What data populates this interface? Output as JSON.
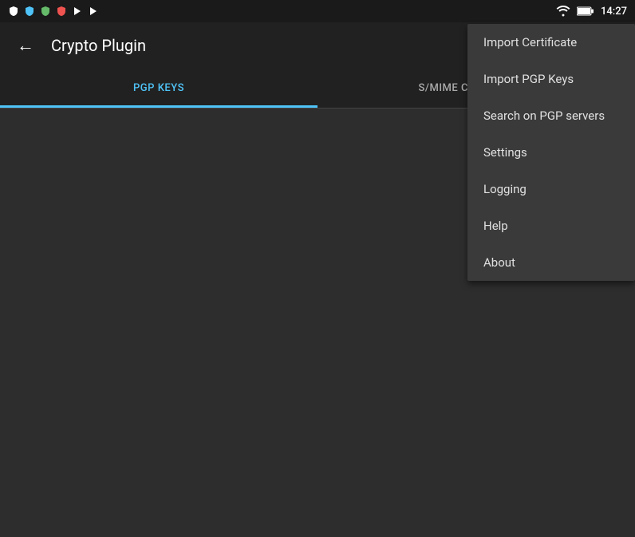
{
  "statusBar": {
    "time": "14:27",
    "icons": [
      "shield",
      "vpn",
      "shield2",
      "antivirus",
      "play",
      "play2"
    ]
  },
  "appBar": {
    "title": "Crypto Plugin",
    "backLabel": "←",
    "overflowLabel": "⋮"
  },
  "tabs": [
    {
      "id": "pgp-keys",
      "label": "PGP KEYS",
      "active": true
    },
    {
      "id": "smime",
      "label": "S/MIME CERTIFICATES",
      "active": false
    }
  ],
  "dropdownMenu": {
    "items": [
      {
        "id": "import-certificate",
        "label": "Import Certificate"
      },
      {
        "id": "import-pgp-keys",
        "label": "Import PGP Keys"
      },
      {
        "id": "search-pgp-servers",
        "label": "Search on PGP servers"
      },
      {
        "id": "settings",
        "label": "Settings"
      },
      {
        "id": "logging",
        "label": "Logging"
      },
      {
        "id": "help",
        "label": "Help"
      },
      {
        "id": "about",
        "label": "About"
      }
    ]
  },
  "colors": {
    "accent": "#4fc3f7",
    "background": "#2d2d2d",
    "appBar": "#212121",
    "statusBar": "#1a1a1a",
    "menuBackground": "#3a3a3a",
    "textPrimary": "#ffffff",
    "textSecondary": "#aaaaaa",
    "menuText": "#e0e0e0"
  }
}
